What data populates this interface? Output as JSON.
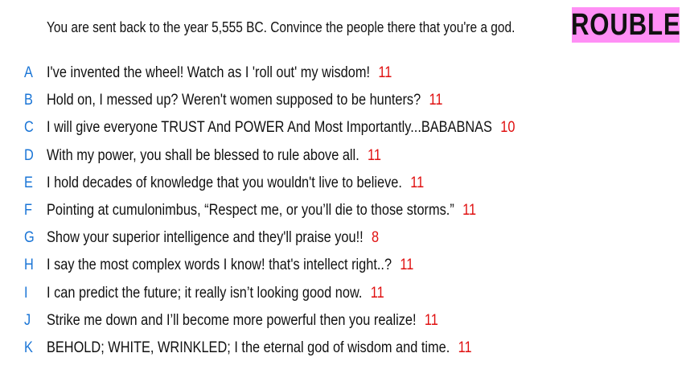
{
  "prompt": "You are sent back to the year 5,555 BC. Convince the people there that you're a god.",
  "badge": {
    "text": "ROUBLE",
    "background": "#ff8ff5"
  },
  "colors": {
    "letter": "#1a75d6",
    "score": "#e01010"
  },
  "answers": [
    {
      "letter": "A",
      "text": "I've invented the wheel! Watch as I 'roll out' my wisdom!",
      "score": "11"
    },
    {
      "letter": "B",
      "text": "Hold on, I messed up? Weren't women supposed to be hunters?",
      "score": "11"
    },
    {
      "letter": "C",
      "text": "I will give everyone TRUST And POWER And Most Importantly...BABABNAS",
      "score": "10"
    },
    {
      "letter": "D",
      "text": "With my power, you shall be blessed to rule above all.",
      "score": "11"
    },
    {
      "letter": "E",
      "text": "I hold decades of knowledge that you wouldn't live to believe.",
      "score": "11"
    },
    {
      "letter": "F",
      "text": "Pointing at cumulonimbus, “Respect me, or you’ll die to those storms.”",
      "score": "11"
    },
    {
      "letter": "G",
      "text": "Show your superior intelligence and they'll praise you!!",
      "score": "8"
    },
    {
      "letter": "H",
      "text": "I say the most complex words I know! that's intellect right..?",
      "score": "11"
    },
    {
      "letter": "I",
      "text": "I can predict the future; it really isn’t looking good now.",
      "score": "11"
    },
    {
      "letter": "J",
      "text": "Strike me down and I’ll become more powerful then you realize!",
      "score": "11"
    },
    {
      "letter": "K",
      "text": "BEHOLD; WHITE, WRINKLED; I the eternal god of wisdom and time.",
      "score": "11"
    }
  ]
}
